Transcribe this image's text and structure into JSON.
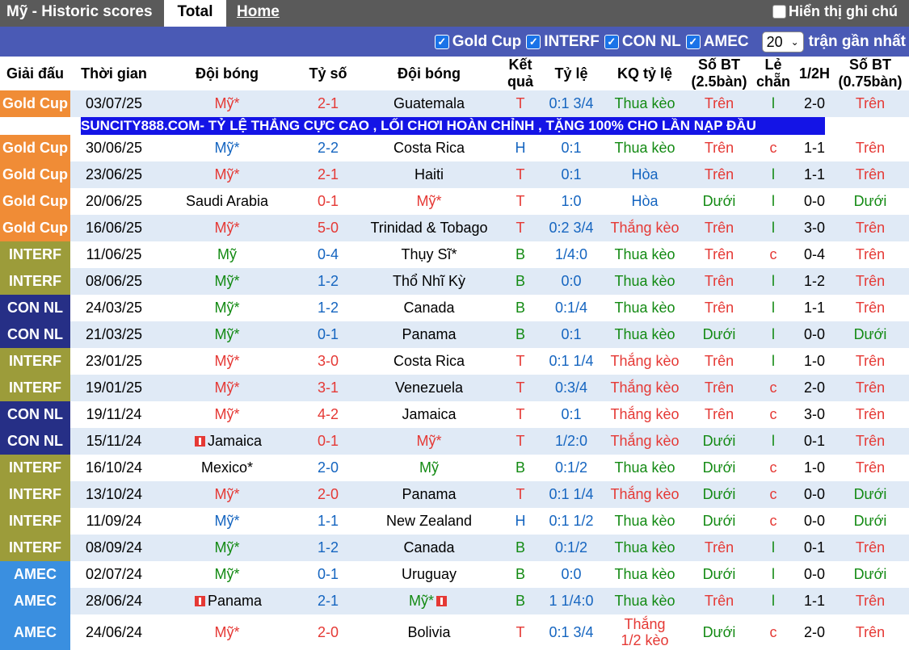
{
  "header": {
    "title": "Mỹ - Historic scores",
    "tab_total": "Total",
    "tab_home": "Home",
    "notes_label": "Hiển thị ghi chú"
  },
  "filters": {
    "items": [
      "Gold Cup",
      "INTERF",
      "CON NL",
      "AMEC"
    ],
    "count_value": "20",
    "count_label": "trận gần nhất"
  },
  "columns": [
    "Giải đấu",
    "Thời gian",
    "Đội bóng",
    "Tỷ số",
    "Đội bóng",
    "Kết quả",
    "Tỷ lệ",
    "KQ tỷ lệ",
    "Số BT (2.5bàn)",
    "Lẻ chẵn",
    "1/2H",
    "Số BT (0.75bàn)"
  ],
  "ad_text": "SUNCITY888.COM- TỶ LỆ THẮNG CỰC CAO , LỐI CHƠI HOÀN CHỈNH , TẶNG 100% CHO LẦN NẠP ĐẦU",
  "colors": {
    "gold_cup": "#f08c36",
    "interf": "#9c9c3a",
    "con_nl": "#262f86",
    "amec": "#3a8fe0",
    "win": "#e53935",
    "draw": "#1565c0",
    "loss": "#138a13"
  },
  "matches": [
    {
      "league": "Gold Cup",
      "date": "03/07/25",
      "home": "Mỹ*",
      "score": "2-1",
      "away": "Guatemala",
      "result": "T",
      "odds": "0:1 3/4",
      "odds_result": "Thua kèo",
      "ou": "Trên",
      "oe": "l",
      "half": "2-0",
      "ou2": "Trên"
    },
    {
      "league": "Gold Cup",
      "date": "30/06/25",
      "home": "Mỹ*",
      "score": "2-2",
      "away": "Costa Rica",
      "result": "H",
      "odds": "0:1",
      "odds_result": "Thua kèo",
      "ou": "Trên",
      "oe": "c",
      "half": "1-1",
      "ou2": "Trên"
    },
    {
      "league": "Gold Cup",
      "date": "23/06/25",
      "home": "Mỹ*",
      "score": "2-1",
      "away": "Haiti",
      "result": "T",
      "odds": "0:1",
      "odds_result": "Hòa",
      "ou": "Trên",
      "oe": "l",
      "half": "1-1",
      "ou2": "Trên"
    },
    {
      "league": "Gold Cup",
      "date": "20/06/25",
      "home": "Saudi Arabia",
      "score": "0-1",
      "away": "Mỹ*",
      "result": "T",
      "odds": "1:0",
      "odds_result": "Hòa",
      "ou": "Dưới",
      "oe": "l",
      "half": "0-0",
      "ou2": "Dưới"
    },
    {
      "league": "Gold Cup",
      "date": "16/06/25",
      "home": "Mỹ*",
      "score": "5-0",
      "away": "Trinidad & Tobago",
      "result": "T",
      "odds": "0:2 3/4",
      "odds_result": "Thắng kèo",
      "ou": "Trên",
      "oe": "l",
      "half": "3-0",
      "ou2": "Trên"
    },
    {
      "league": "INTERF",
      "date": "11/06/25",
      "home": "Mỹ",
      "score": "0-4",
      "away": "Thụy Sĩ*",
      "result": "B",
      "odds": "1/4:0",
      "odds_result": "Thua kèo",
      "ou": "Trên",
      "oe": "c",
      "half": "0-4",
      "ou2": "Trên"
    },
    {
      "league": "INTERF",
      "date": "08/06/25",
      "home": "Mỹ*",
      "score": "1-2",
      "away": "Thổ Nhĩ Kỳ",
      "result": "B",
      "odds": "0:0",
      "odds_result": "Thua kèo",
      "ou": "Trên",
      "oe": "l",
      "half": "1-2",
      "ou2": "Trên"
    },
    {
      "league": "CON NL",
      "date": "24/03/25",
      "home": "Mỹ*",
      "score": "1-2",
      "away": "Canada",
      "result": "B",
      "odds": "0:1/4",
      "odds_result": "Thua kèo",
      "ou": "Trên",
      "oe": "l",
      "half": "1-1",
      "ou2": "Trên"
    },
    {
      "league": "CON NL",
      "date": "21/03/25",
      "home": "Mỹ*",
      "score": "0-1",
      "away": "Panama",
      "result": "B",
      "odds": "0:1",
      "odds_result": "Thua kèo",
      "ou": "Dưới",
      "oe": "l",
      "half": "0-0",
      "ou2": "Dưới"
    },
    {
      "league": "INTERF",
      "date": "23/01/25",
      "home": "Mỹ*",
      "score": "3-0",
      "away": "Costa Rica",
      "result": "T",
      "odds": "0:1 1/4",
      "odds_result": "Thắng kèo",
      "ou": "Trên",
      "oe": "l",
      "half": "1-0",
      "ou2": "Trên"
    },
    {
      "league": "INTERF",
      "date": "19/01/25",
      "home": "Mỹ*",
      "score": "3-1",
      "away": "Venezuela",
      "result": "T",
      "odds": "0:3/4",
      "odds_result": "Thắng kèo",
      "ou": "Trên",
      "oe": "c",
      "half": "2-0",
      "ou2": "Trên"
    },
    {
      "league": "CON NL",
      "date": "19/11/24",
      "home": "Mỹ*",
      "score": "4-2",
      "away": "Jamaica",
      "result": "T",
      "odds": "0:1",
      "odds_result": "Thắng kèo",
      "ou": "Trên",
      "oe": "c",
      "half": "3-0",
      "ou2": "Trên"
    },
    {
      "league": "CON NL",
      "date": "15/11/24",
      "home": "Jamaica",
      "home_flag": true,
      "score": "0-1",
      "away": "Mỹ*",
      "result": "T",
      "odds": "1/2:0",
      "odds_result": "Thắng kèo",
      "ou": "Dưới",
      "oe": "l",
      "half": "0-1",
      "ou2": "Trên"
    },
    {
      "league": "INTERF",
      "date": "16/10/24",
      "home": "Mexico*",
      "score": "2-0",
      "away": "Mỹ",
      "result": "B",
      "odds": "0:1/2",
      "odds_result": "Thua kèo",
      "ou": "Dưới",
      "oe": "c",
      "half": "1-0",
      "ou2": "Trên"
    },
    {
      "league": "INTERF",
      "date": "13/10/24",
      "home": "Mỹ*",
      "score": "2-0",
      "away": "Panama",
      "result": "T",
      "odds": "0:1 1/4",
      "odds_result": "Thắng kèo",
      "ou": "Dưới",
      "oe": "c",
      "half": "0-0",
      "ou2": "Dưới"
    },
    {
      "league": "INTERF",
      "date": "11/09/24",
      "home": "Mỹ*",
      "score": "1-1",
      "away": "New Zealand",
      "result": "H",
      "odds": "0:1 1/2",
      "odds_result": "Thua kèo",
      "ou": "Dưới",
      "oe": "c",
      "half": "0-0",
      "ou2": "Dưới"
    },
    {
      "league": "INTERF",
      "date": "08/09/24",
      "home": "Mỹ*",
      "score": "1-2",
      "away": "Canada",
      "result": "B",
      "odds": "0:1/2",
      "odds_result": "Thua kèo",
      "ou": "Trên",
      "oe": "l",
      "half": "0-1",
      "ou2": "Trên"
    },
    {
      "league": "AMEC",
      "date": "02/07/24",
      "home": "Mỹ*",
      "score": "0-1",
      "away": "Uruguay",
      "result": "B",
      "odds": "0:0",
      "odds_result": "Thua kèo",
      "ou": "Dưới",
      "oe": "l",
      "half": "0-0",
      "ou2": "Dưới"
    },
    {
      "league": "AMEC",
      "date": "28/06/24",
      "home": "Panama",
      "home_flag": true,
      "score": "2-1",
      "away": "Mỹ*",
      "away_flag": true,
      "result": "B",
      "odds": "1 1/4:0",
      "odds_result": "Thua kèo",
      "ou": "Trên",
      "oe": "l",
      "half": "1-1",
      "ou2": "Trên"
    },
    {
      "league": "AMEC",
      "date": "24/06/24",
      "home": "Mỹ*",
      "score": "2-0",
      "away": "Bolivia",
      "result": "T",
      "odds": "0:1 3/4",
      "odds_result": "Thắng 1/2 kèo",
      "ou": "Dưới",
      "oe": "c",
      "half": "2-0",
      "ou2": "Trên"
    }
  ]
}
